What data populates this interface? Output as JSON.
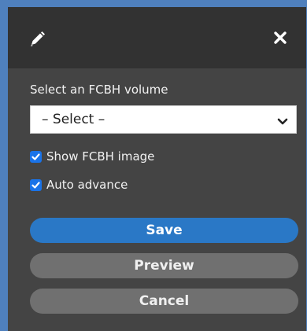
{
  "header": {
    "edit_icon": "pencil-icon",
    "close_icon": "close-icon"
  },
  "form": {
    "volume_label": "Select an FCBH volume",
    "volume_select_value": "– Select –",
    "show_image_label": "Show FCBH image",
    "show_image_checked": true,
    "auto_advance_label": "Auto advance",
    "auto_advance_checked": true
  },
  "buttons": {
    "save": "Save",
    "preview": "Preview",
    "cancel": "Cancel"
  },
  "colors": {
    "accent": "#2a78c6",
    "checkbox": "#1a73e8",
    "panel": "#444444",
    "header": "#323232"
  }
}
